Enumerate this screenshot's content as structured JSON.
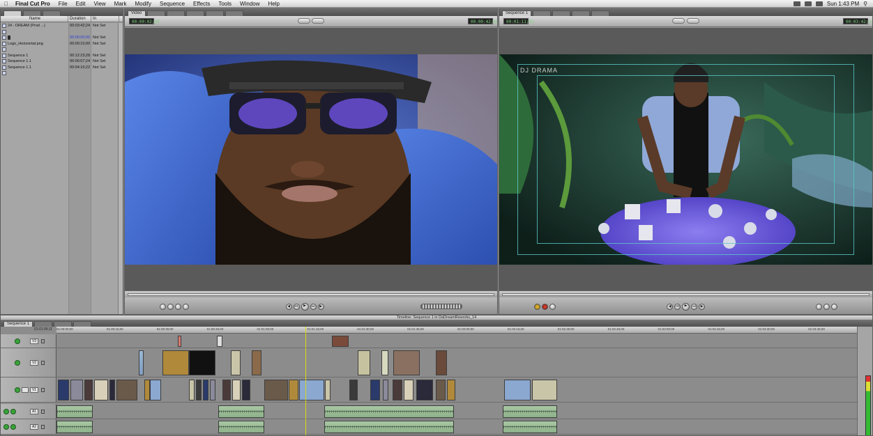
{
  "menubar": {
    "app_name": "Final Cut Pro",
    "items": [
      "File",
      "Edit",
      "View",
      "Mark",
      "Modify",
      "Sequence",
      "Effects",
      "Tools",
      "Window",
      "Help"
    ],
    "clock": "Sun 1:43 PM"
  },
  "browser": {
    "tabs": [
      {
        "label": ""
      },
      {
        "label": ""
      },
      {
        "label": ""
      }
    ],
    "columns": {
      "name": "Name",
      "duration": "Duration",
      "in": "In"
    },
    "rows": [
      {
        "name": "24 - DREAM (Prod ...)",
        "duration": "00:03:42;24",
        "in": "Not Set",
        "selected": false
      },
      {
        "name": "",
        "duration": "",
        "in": "",
        "selected": false
      },
      {
        "name": "",
        "duration": "00:00:00;00",
        "in": "Not Set",
        "selected": true
      },
      {
        "name": "Logo_Horizontal.png",
        "duration": "00:00:10;00",
        "in": "Not Set",
        "selected": false
      },
      {
        "name": "",
        "duration": "",
        "in": "",
        "selected": false
      },
      {
        "name": "Sequence 1",
        "duration": "00:12:23;28",
        "in": "Not Set",
        "selected": false
      },
      {
        "name": "Sequence 1.1",
        "duration": "00:06:07;24",
        "in": "Not Set",
        "selected": false
      },
      {
        "name": "Sequence 1.1",
        "duration": "00:04:16;22",
        "in": "Not Set",
        "selected": false
      },
      {
        "name": "",
        "duration": "",
        "in": "",
        "selected": false
      }
    ]
  },
  "viewer": {
    "tabs": [
      {
        "label": "Video"
      },
      {
        "label": ""
      },
      {
        "label": ""
      },
      {
        "label": ""
      },
      {
        "label": ""
      },
      {
        "label": ""
      }
    ],
    "timecode_left": "00:00:02;00",
    "timecode_right": "00:00:42;08"
  },
  "canvas": {
    "tabs": [
      {
        "label": "Sequence 1"
      },
      {
        "label": ""
      },
      {
        "label": ""
      },
      {
        "label": ""
      },
      {
        "label": ""
      }
    ],
    "timecode_left": "00:01:11;01",
    "timecode_right": "00:03:42;22",
    "overlay_text": "DJ DRAMA"
  },
  "timeline": {
    "title": "Timeline: Sequence 1 in DaDreamReworks_14",
    "tabs": [
      {
        "label": "Sequence 1"
      },
      {
        "label": ""
      },
      {
        "label": ""
      },
      {
        "label": ""
      }
    ],
    "current_timecode": "01:01:09;11",
    "ruler": [
      "01:00:00;00",
      "01:00:15;00",
      "01:00:30;00",
      "01:00:45;00",
      "01:01:00;00",
      "01:01:15;00",
      "01:01:30;00",
      "01:01:45;00",
      "01:02:00;00",
      "01:02:15;00",
      "01:02:30;00",
      "01:02:45;00",
      "01:03:00;00",
      "01:03:15;00",
      "01:03:30;00",
      "01:03:45;00"
    ],
    "tracks": [
      {
        "label": "V3",
        "kind": "video"
      },
      {
        "label": "V2",
        "kind": "video"
      },
      {
        "label": "V1",
        "kind": "video"
      },
      {
        "label": "A1",
        "kind": "audio"
      },
      {
        "label": "A2",
        "kind": "audio"
      }
    ]
  },
  "colors": {
    "accent": "#3aa33a",
    "playhead": "#d8d814",
    "video_clip": "#8eaacb",
    "audio_clip": "#9cbd98"
  }
}
